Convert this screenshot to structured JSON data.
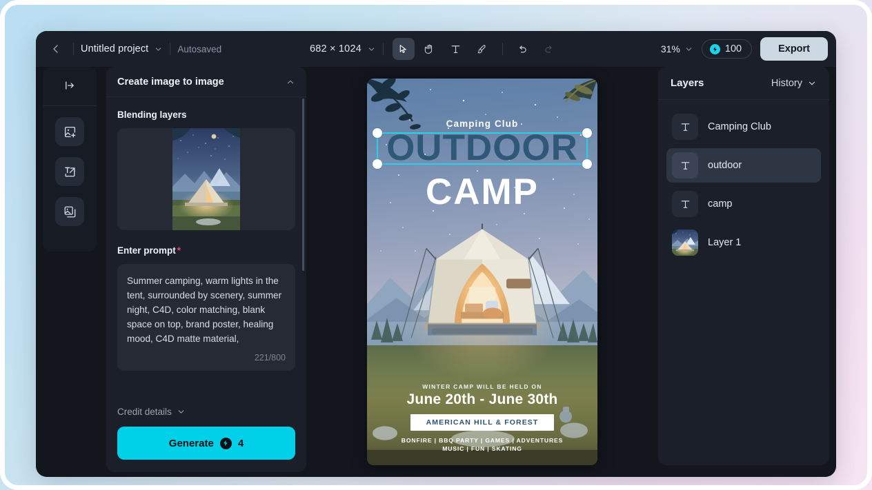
{
  "topbar": {
    "back_icon": "chevron-left-icon",
    "project_name": "Untitled project",
    "project_dropdown_icon": "chevron-down-icon",
    "autosaved_label": "Autosaved",
    "canvas_dimensions": "682 × 1024",
    "dimensions_dropdown_icon": "chevron-down-icon",
    "tools": [
      {
        "name": "select-tool",
        "icon": "cursor-arrow-icon",
        "active": true,
        "disabled": false
      },
      {
        "name": "hand-tool",
        "icon": "hand-icon",
        "active": false,
        "disabled": false
      },
      {
        "name": "text-tool",
        "icon": "text-t-icon",
        "active": false,
        "disabled": false
      },
      {
        "name": "brush-tool",
        "icon": "brush-icon",
        "active": false,
        "disabled": false
      }
    ],
    "undo_icon": "undo-arrow-icon",
    "redo_icon": "redo-arrow-icon",
    "zoom_level": "31%",
    "zoom_dropdown_icon": "chevron-down-icon",
    "credits": {
      "icon": "bolt-credit-icon",
      "value": "100"
    },
    "export_label": "Export"
  },
  "rail": {
    "expand_icon": "panel-expand-icon",
    "buttons": [
      {
        "name": "add-image-tool",
        "icon": "image-plus-icon"
      },
      {
        "name": "text-to-image-tool",
        "icon": "text-to-image-icon"
      },
      {
        "name": "image-stack-tool",
        "icon": "image-stack-icon"
      }
    ]
  },
  "panel": {
    "title": "Create image to image",
    "collapse_icon": "chevron-up-icon",
    "blending_layers_label": "Blending layers",
    "blending_thumbnail_alt": "camping tent at night thumbnail",
    "prompt_label": "Enter prompt",
    "prompt_required_mark": "*",
    "prompt_value": "Summer camping, warm lights in the tent, surrounded by scenery, summer night, C4D, color matching, blank space on top, brand poster, healing mood, C4D matte material,",
    "prompt_counter": "221/800",
    "credit_details_label": "Credit details",
    "credit_details_icon": "chevron-down-icon",
    "generate_label": "Generate",
    "generate_cost": "4",
    "generate_icon": "bolt-credit-icon",
    "accent_color": "#00d1e8"
  },
  "canvas": {
    "selection_color": "#2ccfe8",
    "poster": {
      "club_line": "Camping Club",
      "headline_top": "OUTDOOR",
      "headline_bottom": "CAMP",
      "headline_top_color": "#2f5876",
      "headline_bottom_color": "#ffffff",
      "kicker": "WINTER CAMP WILL BE HELD ON",
      "dates": "June 20th - June 30th",
      "venue": "AMERICAN HILL & FOREST",
      "activities_line1": "BONFIRE  |  BBQ PARTY  |  GAMES  |  ADVENTURES",
      "activities_line2": "MUSIC  |  FUN  |  SKATING"
    }
  },
  "layers": {
    "title": "Layers",
    "history_tab": "History",
    "history_icon": "chevron-down-icon",
    "items": [
      {
        "name": "Camping Club",
        "icon": "text-layer-icon",
        "selected": false
      },
      {
        "name": "outdoor",
        "icon": "text-layer-icon",
        "selected": true
      },
      {
        "name": "camp",
        "icon": "text-layer-icon",
        "selected": false
      },
      {
        "name": "Layer 1",
        "icon": "image-layer-thumbnail",
        "selected": false
      }
    ]
  }
}
